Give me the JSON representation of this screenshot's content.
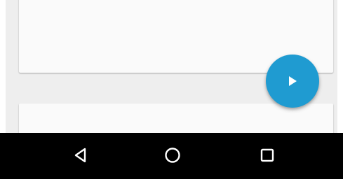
{
  "screen": {
    "background_color": "#eeeeee",
    "card_color": "#fafafa"
  },
  "fab": {
    "icon": "play-icon",
    "color": "#1f9bd1",
    "icon_color": "#ffffff"
  },
  "nav_bar": {
    "color": "#000000",
    "icon_color": "#ffffff",
    "buttons": [
      {
        "icon": "back-triangle-icon"
      },
      {
        "icon": "home-circle-icon"
      },
      {
        "icon": "recents-square-icon"
      }
    ]
  }
}
